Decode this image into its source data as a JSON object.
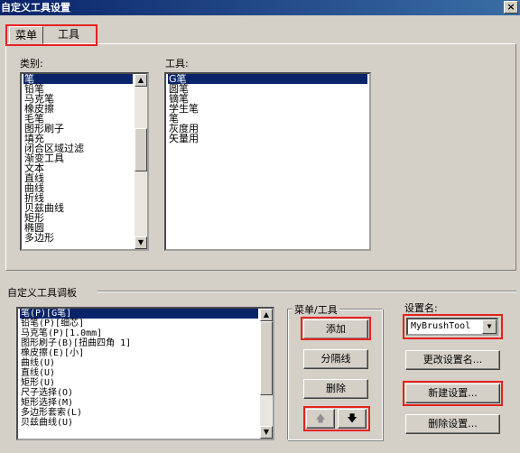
{
  "window": {
    "title": "自定义工具设置",
    "close_glyph": "×"
  },
  "tabs": [
    {
      "label": "菜单",
      "active": true
    },
    {
      "label": "工具",
      "active": false
    }
  ],
  "category_label": "类别:",
  "categories": [
    "笔",
    "铅笔",
    "马克笔",
    "橡皮擦",
    "毛笔",
    "图形刷子",
    "填充",
    "闭合区域过滤",
    "渐变工具",
    "文本",
    "直线",
    "曲线",
    "折线",
    "贝兹曲线",
    "矩形",
    "椭圆",
    "多边形"
  ],
  "categories_selected": 0,
  "tools_label": "工具:",
  "tools": [
    "G笔",
    "圆笔",
    "镝笔",
    "学生笔",
    "笔",
    "灰度用",
    "矢量用"
  ],
  "tools_selected": 0,
  "palette_label": "自定义工具调板",
  "palette_items": [
    "笔(P)[G笔]",
    "铅笔(P)[细芯]",
    "马克笔(P)[1.0mm]",
    "图形刷子(B)[扭曲四角 1]",
    "橡皮擦(E)[小]",
    "曲线(U)",
    "直线(U)",
    "矩形(U)",
    "尺子选择(O)",
    "矩形选择(M)",
    "多边形套索(L)",
    "贝兹曲线(U)"
  ],
  "palette_selected": 0,
  "menu_tool_group": {
    "label": "菜单/工具",
    "add": "添加",
    "separator": "分隔线",
    "delete": "删除",
    "up_glyph": "🡅",
    "down_glyph": "🡇"
  },
  "settings": {
    "name_label": "设置名:",
    "name_value": "MyBrushTool",
    "rename": "更改设置名...",
    "new": "新建设置...",
    "delete": "删除设置..."
  },
  "scroll_glyphs": {
    "up": "▲",
    "down": "▼",
    "combo": "▼"
  },
  "colors": {
    "highlight": "#e6211f",
    "selection": "#0a246a",
    "face": "#d4d0c8"
  }
}
